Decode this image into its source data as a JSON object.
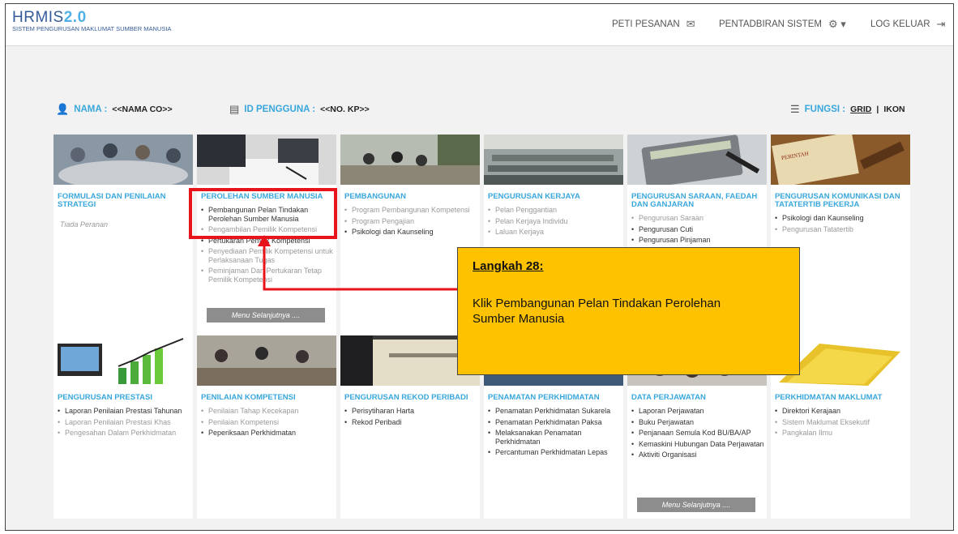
{
  "header": {
    "logo": "HRMIS",
    "logo_version": "2.0",
    "logo_sub": "SISTEM PENGURUSAN MAKLUMAT SUMBER MANUSIA",
    "nav": [
      {
        "label": "PETI PESANAN",
        "icon": "mail-icon"
      },
      {
        "label": "PENTADBIRAN SISTEM",
        "icon": "gear-icon"
      },
      {
        "label": "LOG KELUAR",
        "icon": "logout-icon"
      }
    ]
  },
  "info": {
    "nama_label": "NAMA :",
    "nama_value": "<<NAMA CO>>",
    "id_label": "ID PENGGUNA :",
    "id_value": "<<NO. KP>>",
    "fungsi_label": "FUNGSI :",
    "grid": "GRID",
    "sep": "|",
    "ikon": "IKON"
  },
  "tiles": [
    {
      "title": "FORMULASI DAN PENILAIAN STRATEGI",
      "empty": "Tiada Peranan",
      "items": []
    },
    {
      "title": "PEROLEHAN SUMBER MANUSIA",
      "items": [
        {
          "t": "Pembangunan Pelan Tindakan Perolehan Sumber Manusia",
          "m": false
        },
        {
          "t": "Pengambilan Pemilik Kompetensi",
          "m": true
        },
        {
          "t": "Pertukaran Pemilik Kompetensi",
          "m": false
        },
        {
          "t": "Penyediaan Pemilik Kompetensi untuk Perlaksanaan Tugas",
          "m": true
        },
        {
          "t": "Peminjaman Dan Pertukaran Tetap Pemilik Kompetensi",
          "m": true
        }
      ],
      "more": "Menu Selanjutnya ...."
    },
    {
      "title": "PEMBANGUNAN",
      "items": [
        {
          "t": "Program Pembangunan Kompetensi",
          "m": true
        },
        {
          "t": "Program Pengajian",
          "m": true
        },
        {
          "t": "Psikologi dan Kaunseling",
          "m": false
        }
      ]
    },
    {
      "title": "PENGURUSAN KERJAYA",
      "items": [
        {
          "t": "Pelan Penggantian",
          "m": true
        },
        {
          "t": "Pelan Kerjaya Individu",
          "m": true
        },
        {
          "t": "Laluan Kerjaya",
          "m": true
        }
      ]
    },
    {
      "title": "PENGURUSAN SARAAN, FAEDAH DAN GANJARAN",
      "items": [
        {
          "t": "Pengurusan Saraan",
          "m": true
        },
        {
          "t": "Pengurusan Cuti",
          "m": false
        },
        {
          "t": "Pengurusan Pinjaman",
          "m": false
        }
      ]
    },
    {
      "title": "PENGURUSAN KOMUNIKASI DAN TATATERTIB PEKERJA",
      "items": [
        {
          "t": "Psikologi dan Kaunseling",
          "m": false
        },
        {
          "t": "Pengurusan Tatatertib",
          "m": true
        }
      ]
    },
    {
      "title": "PENGURUSAN PRESTASI",
      "items": [
        {
          "t": "Laporan Penilaian Prestasi Tahunan",
          "m": false
        },
        {
          "t": "Laporan Penilaian Prestasi Khas",
          "m": true
        },
        {
          "t": "Pengesahan Dalam Perkhidmatan",
          "m": true
        }
      ]
    },
    {
      "title": "PENILAIAN KOMPETENSI",
      "items": [
        {
          "t": "Penilaian Tahap Kecekapan",
          "m": true
        },
        {
          "t": "Penilaian Kompetensi",
          "m": true
        },
        {
          "t": "Peperiksaan Perkhidmatan",
          "m": false
        }
      ]
    },
    {
      "title": "PENGURUSAN REKOD PERIBADI",
      "items": [
        {
          "t": "Perisytiharan Harta",
          "m": false
        },
        {
          "t": "Rekod Peribadi",
          "m": false
        }
      ]
    },
    {
      "title": "PENAMATAN PERKHIDMATAN",
      "items": [
        {
          "t": "Penamatan Perkhidmatan Sukarela",
          "m": false
        },
        {
          "t": "Penamatan Perkhidmatan Paksa",
          "m": false
        },
        {
          "t": "Melaksanakan Penamatan Perkhidmatan",
          "m": false
        },
        {
          "t": "Percantuman Perkhidmatan Lepas",
          "m": false
        }
      ]
    },
    {
      "title": "DATA PERJAWATAN",
      "items": [
        {
          "t": "Laporan Perjawatan",
          "m": false
        },
        {
          "t": "Buku Perjawatan",
          "m": false
        },
        {
          "t": "Penjanaan Semula Kod BU/BA/AP",
          "m": false
        },
        {
          "t": "Kemaskini Hubungan Data Perjawatan",
          "m": false
        },
        {
          "t": "Aktiviti Organisasi",
          "m": false
        }
      ],
      "more": "Menu Selanjutnya ...."
    },
    {
      "title": "PERKHIDMATAN MAKLUMAT",
      "items": [
        {
          "t": "Direktori Kerajaan",
          "m": false
        },
        {
          "t": "Sistem Maklumat Eksekutif",
          "m": true
        },
        {
          "t": "Pangkalan Ilmu",
          "m": true
        }
      ]
    }
  ],
  "callout": {
    "heading": "Langkah 28:",
    "body": "Klik Pembangunan Pelan Tindakan Perolehan Sumber Manusia"
  },
  "colors": {
    "accent": "#3aa7dc",
    "highlight": "#e8141c",
    "callout": "#fec200"
  }
}
